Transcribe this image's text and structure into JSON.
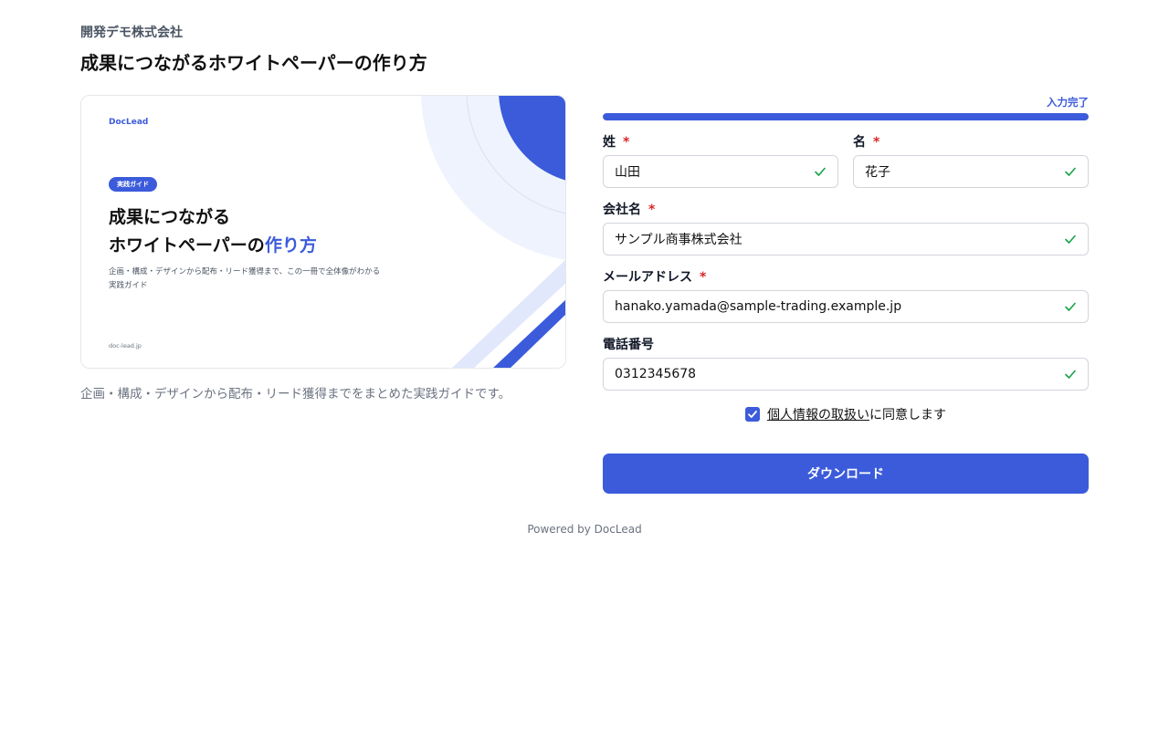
{
  "header": {
    "company": "開発デモ株式会社",
    "title": "成果につながるホワイトペーパーの作り方"
  },
  "cover": {
    "brand": "DocLead",
    "badge": "実践ガイド",
    "title_line1": "成果につながる",
    "title_line2_plain": "ホワイトペーパーの",
    "title_line2_highlight": "作り方",
    "description": "企画・構成・デザインから配布・リード獲得まで、この一冊で全体像がわかる実践ガイド",
    "url": "doc-lead.jp"
  },
  "caption": "企画・構成・デザインから配布・リード獲得までをまとめた実践ガイドです。",
  "progress": {
    "label": "入力完了",
    "percent": 100
  },
  "form": {
    "required_mark": "*",
    "last_name": {
      "label": "姓",
      "value": "山田"
    },
    "first_name": {
      "label": "名",
      "value": "花子"
    },
    "company": {
      "label": "会社名",
      "value": "サンプル商事株式会社"
    },
    "email": {
      "label": "メールアドレス",
      "value": "hanako.yamada@sample-trading.example.jp"
    },
    "phone": {
      "label": "電話番号",
      "value": "0312345678"
    },
    "consent": {
      "checked": true,
      "link_text": "個人情報の取扱い",
      "suffix": "に同意します"
    },
    "submit_label": "ダウンロード"
  },
  "footer": {
    "powered_by": "Powered by DocLead"
  },
  "colors": {
    "accent": "#3b5bdb",
    "valid": "#16a34a",
    "required": "#dc2626"
  },
  "icons": {
    "field_valid": "check-icon",
    "consent_checkbox": "checkmark-icon"
  }
}
